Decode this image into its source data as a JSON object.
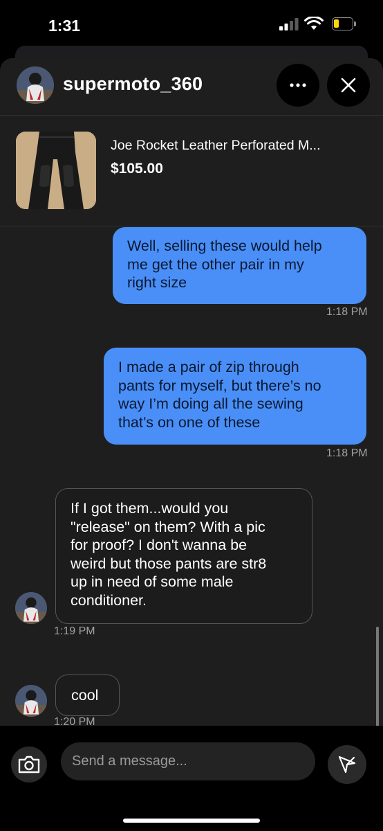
{
  "status_bar": {
    "time": "1:31",
    "battery_level": 0.25,
    "battery_color": "#ffd60a"
  },
  "header": {
    "username": "supermoto_360",
    "more_icon": "ellipsis-icon",
    "close_icon": "close-icon"
  },
  "listing": {
    "title": "Joe Rocket Leather Perforated M...",
    "price": "$105.00"
  },
  "messages": [
    {
      "direction": "sent",
      "lines": [
        "Well, selling these would help",
        "me get the other pair in my",
        "right size"
      ],
      "time": "1:18 PM"
    },
    {
      "direction": "sent",
      "lines": [
        "I made a pair of zip through",
        "pants for myself, but there’s no",
        "way I’m doing all the sewing",
        "that’s on one of these"
      ],
      "time": "1:18 PM"
    },
    {
      "direction": "received",
      "lines": [
        "If I got them...would you",
        "\"release\" on them? With a pic",
        "for proof? I don't wanna be",
        "weird but those pants are str8",
        "up in need of some male",
        "conditioner."
      ],
      "time": "1:19 PM"
    },
    {
      "direction": "received",
      "lines": [
        "cool"
      ],
      "time": "1:20 PM"
    }
  ],
  "composer": {
    "placeholder": "Send a message...",
    "camera_icon": "camera-icon",
    "send_icon": "send-icon"
  },
  "colors": {
    "sent_bubble": "#4a8ff7",
    "received_border": "#555555",
    "sheet_bg": "#1e1e1e"
  }
}
